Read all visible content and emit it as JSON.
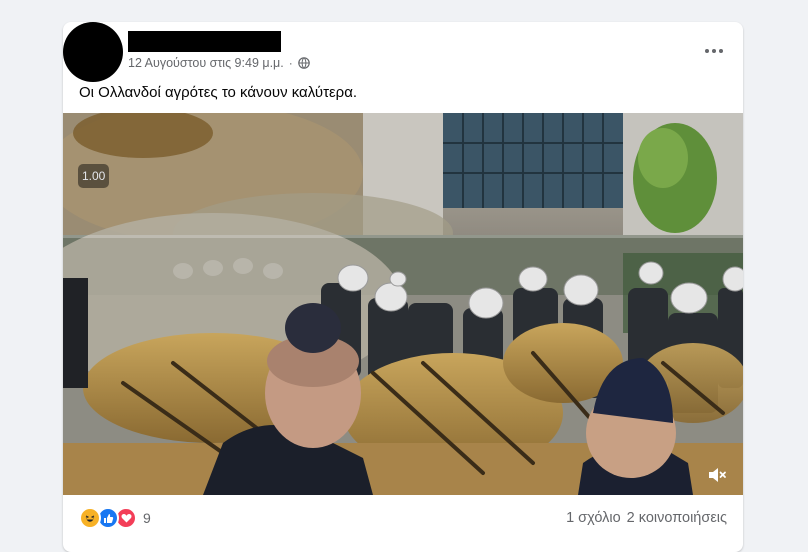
{
  "post": {
    "timestamp": "12 Αυγούστου στις 9:49 μ.μ.",
    "separator": "·",
    "text": "Οι Ολλανδοί αγρότες το κάνουν καλύτερα."
  },
  "video": {
    "speed_label": "1.00"
  },
  "footer": {
    "reaction_count": "9",
    "comments": "1 σχόλιο",
    "shares": "2 κοινοποιήσεις"
  },
  "icons": {
    "more": "more-options-icon",
    "audience": "globe-icon",
    "mute": "speaker-muted-icon",
    "reactions": [
      "haha-icon",
      "like-icon",
      "love-icon"
    ]
  },
  "colors": {
    "secondary_text": "#65676b",
    "like": "#1877f2",
    "love": "#f33e58",
    "haha": "#f7b125"
  }
}
